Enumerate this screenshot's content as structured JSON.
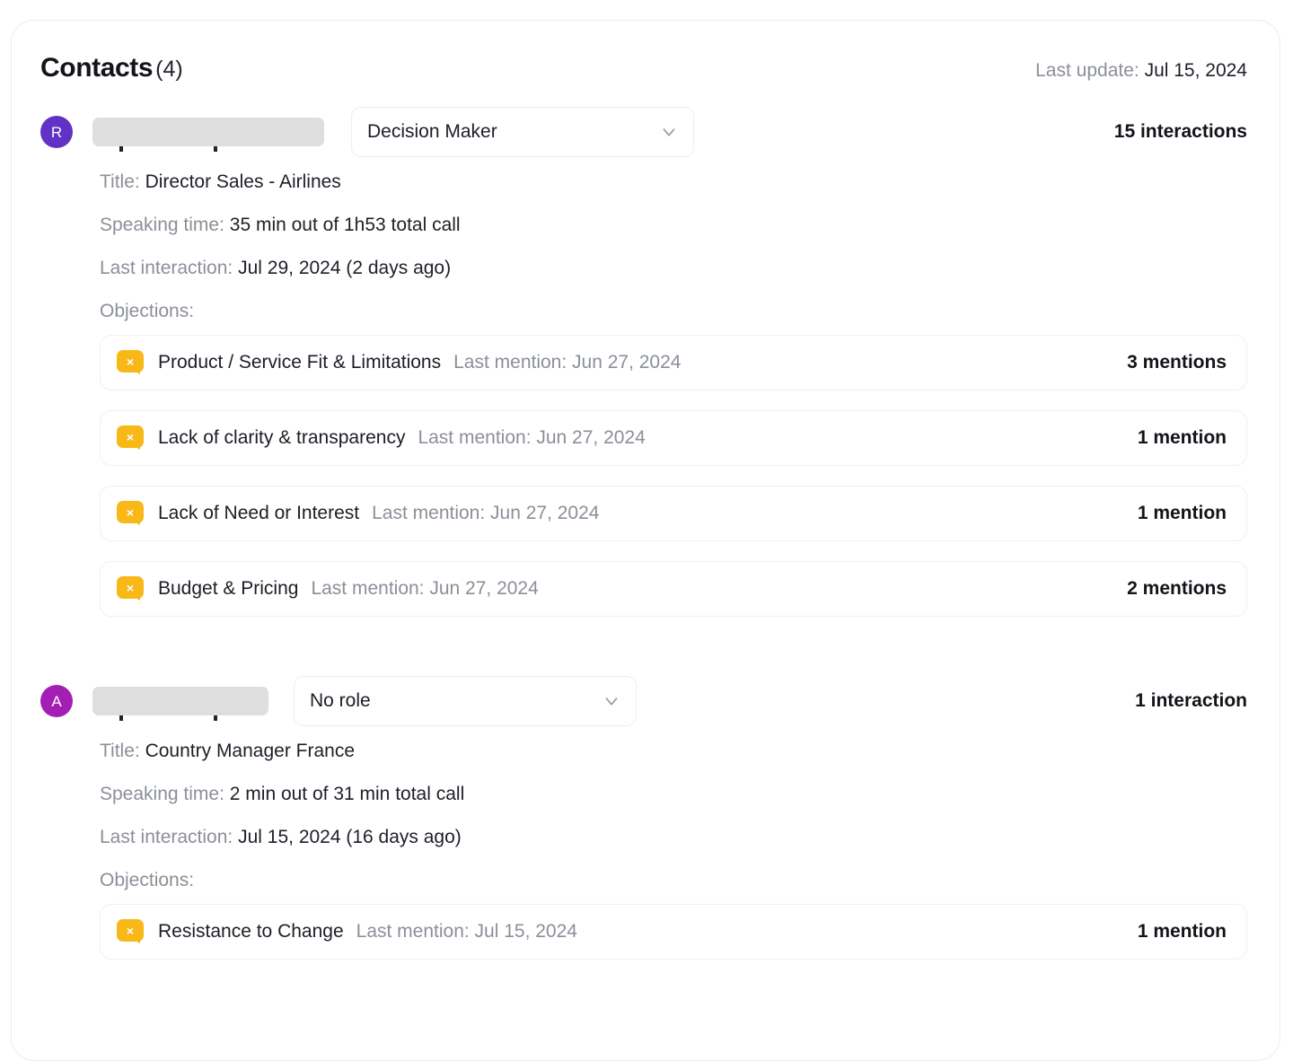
{
  "header": {
    "title": "Contacts",
    "count": "(4)",
    "last_update_label": "Last update:",
    "last_update_value": "Jul 15, 2024"
  },
  "labels": {
    "title_label": "Title:",
    "speaking_label": "Speaking time:",
    "last_interaction_label": "Last interaction:",
    "objections_label": "Objections:"
  },
  "colors": {
    "avatar_1": "#6132c4",
    "avatar_2": "#a31eb5",
    "objection_icon": "#f8b818",
    "redaction": "#dededf"
  },
  "contacts": [
    {
      "avatar_initial": "R",
      "avatar_color": "#6132c4",
      "name_redacted_width": 258,
      "role": "Decision Maker",
      "role_select_width": 382,
      "interactions": "15 interactions",
      "title": "Director Sales - Airlines",
      "speaking_time": "35 min out of 1h53 total call",
      "last_interaction": "Jul 29, 2024 (2 days ago)",
      "objections": [
        {
          "icon": "objection-bubble-icon",
          "name": "Product / Service Fit & Limitations",
          "mention": "Last mention: Jun 27, 2024",
          "count": "3 mentions"
        },
        {
          "icon": "objection-bubble-icon",
          "name": "Lack of clarity & transparency",
          "mention": "Last mention: Jun 27, 2024",
          "count": "1 mention"
        },
        {
          "icon": "objection-bubble-icon",
          "name": "Lack of Need or Interest",
          "mention": "Last mention: Jun 27, 2024",
          "count": "1 mention"
        },
        {
          "icon": "objection-bubble-icon",
          "name": "Budget & Pricing",
          "mention": "Last mention: Jun 27, 2024",
          "count": "2 mentions"
        }
      ]
    },
    {
      "avatar_initial": "A",
      "avatar_color": "#a31eb5",
      "name_redacted_width": 196,
      "role": "No role",
      "role_select_width": 382,
      "interactions": "1 interaction",
      "title": "Country Manager France",
      "speaking_time": "2 min out of 31 min total call",
      "last_interaction": "Jul 15, 2024 (16 days ago)",
      "objections": [
        {
          "icon": "objection-bubble-icon",
          "name": "Resistance to Change",
          "mention": "Last mention: Jul 15, 2024",
          "count": "1 mention"
        }
      ]
    }
  ]
}
